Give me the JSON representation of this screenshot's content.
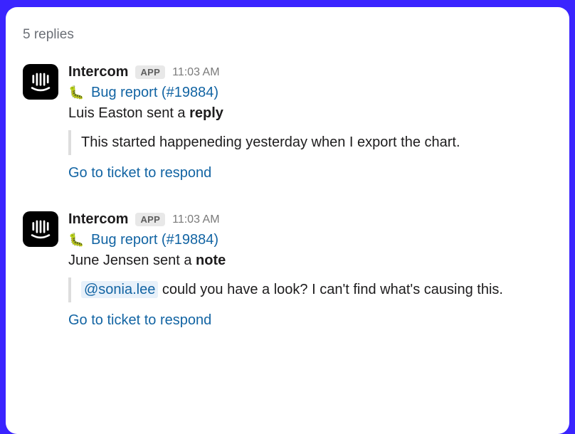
{
  "header": {
    "reply_count": "5 replies"
  },
  "messages": [
    {
      "author": "Intercom",
      "badge": "APP",
      "time": "11:03 AM",
      "bug_emoji": "🐛",
      "report_title": "Bug report (#19884)",
      "action_prefix": "Luis Easton sent a ",
      "action_bold": "reply",
      "quote_parts": [
        {
          "type": "text",
          "text": "This started happeneding yesterday when I export the chart."
        }
      ],
      "cta": "Go to ticket to respond"
    },
    {
      "author": "Intercom",
      "badge": "APP",
      "time": "11:03 AM",
      "bug_emoji": "🐛",
      "report_title": "Bug report (#19884)",
      "action_prefix": "June Jensen sent a ",
      "action_bold": "note",
      "quote_parts": [
        {
          "type": "mention",
          "text": "@sonia.lee"
        },
        {
          "type": "text",
          "text": "  could you have a look? I can't find what's causing this."
        }
      ],
      "cta": "Go to ticket to respond"
    }
  ]
}
